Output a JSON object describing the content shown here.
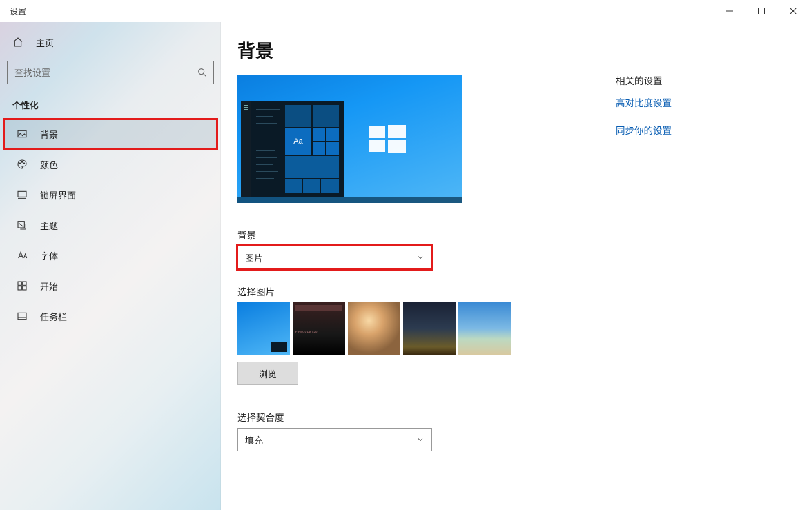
{
  "window": {
    "title": "设置"
  },
  "sidebar": {
    "home": "主页",
    "search_placeholder": "查找设置",
    "category": "个性化",
    "items": [
      {
        "id": "background",
        "label": "背景"
      },
      {
        "id": "colors",
        "label": "颜色"
      },
      {
        "id": "lockscreen",
        "label": "锁屏界面"
      },
      {
        "id": "themes",
        "label": "主题"
      },
      {
        "id": "fonts",
        "label": "字体"
      },
      {
        "id": "start",
        "label": "开始"
      },
      {
        "id": "taskbar",
        "label": "任务栏"
      }
    ]
  },
  "main": {
    "heading": "背景",
    "preview_tile_text": "Aa",
    "background_label": "背景",
    "background_value": "图片",
    "choose_image_label": "选择图片",
    "browse_label": "浏览",
    "fit_label": "选择契合度",
    "fit_value": "填充"
  },
  "related": {
    "heading": "相关的设置",
    "links": [
      "高对比度设置",
      "同步你的设置"
    ]
  }
}
